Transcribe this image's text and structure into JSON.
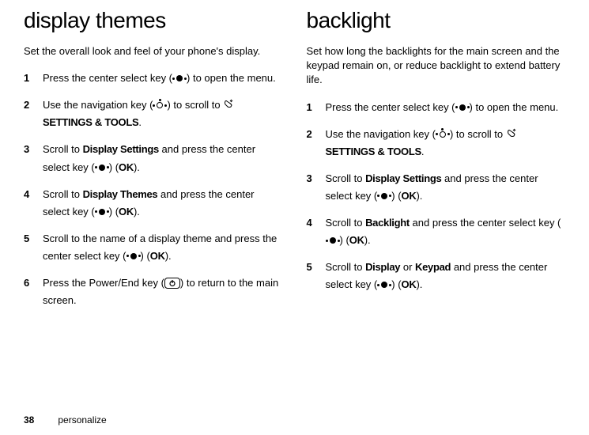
{
  "left": {
    "heading": "display themes",
    "intro": "Set the overall look and feel of your phone's display.",
    "steps": {
      "s1a": "Press the center select key (",
      "s1b": ") to open the menu.",
      "s2a": "Use the navigation key (",
      "s2b": ") to scroll to ",
      "s2c": "SETTINGS & TOOLS",
      "s2d": ".",
      "s3a": "Scroll to ",
      "s3b": "Display Settings",
      "s3c": " and press the center select key (",
      "s3d": ") (",
      "s3e": "OK",
      "s3f": ").",
      "s4a": "Scroll to ",
      "s4b": "Display Themes",
      "s4c": " and press the center select key (",
      "s4d": ") (",
      "s4e": "OK",
      "s4f": ").",
      "s5a": "Scroll to the name of a display theme and press the center select key (",
      "s5b": ") (",
      "s5c": "OK",
      "s5d": ").",
      "s6a": "Press the Power/End key (",
      "s6b": ") to return to the main screen."
    }
  },
  "right": {
    "heading": "backlight",
    "intro": "Set how long the backlights for the main screen and the keypad remain on, or reduce backlight to extend battery life.",
    "steps": {
      "s1a": "Press the center select key (",
      "s1b": ") to open the menu.",
      "s2a": "Use the navigation key (",
      "s2b": ") to scroll to ",
      "s2c": "SETTINGS & TOOLS",
      "s2d": ".",
      "s3a": "Scroll to ",
      "s3b": "Display Settings",
      "s3c": " and press the center select key (",
      "s3d": ") (",
      "s3e": "OK",
      "s3f": ").",
      "s4a": "Scroll to ",
      "s4b": "Backlight",
      "s4c": " and press the center select key (",
      "s4d": ") (",
      "s4e": "OK",
      "s4f": ").",
      "s5a": "Scroll to ",
      "s5b": "Display",
      "s5c": " or ",
      "s5d": "Keypad",
      "s5e": " and press the center select key (",
      "s5f": ") (",
      "s5g": "OK",
      "s5h": ")."
    }
  },
  "footer": {
    "page": "38",
    "section": "personalize"
  }
}
